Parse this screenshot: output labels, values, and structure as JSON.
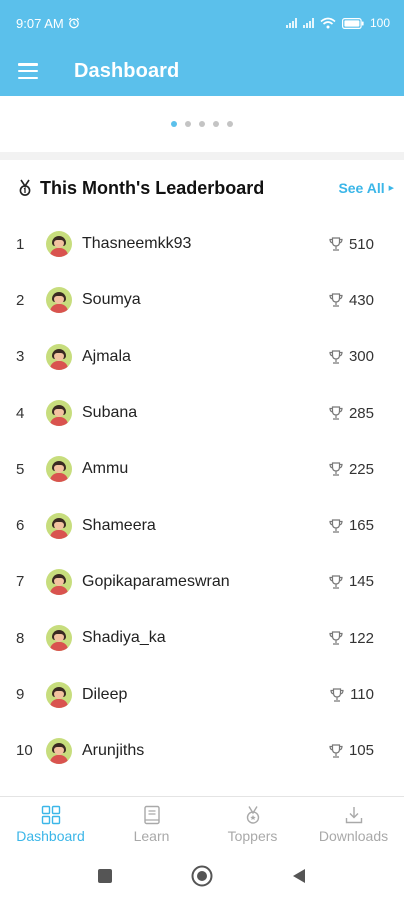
{
  "status_bar": {
    "time": "9:07 AM",
    "battery": "100"
  },
  "app_bar": {
    "title": "Dashboard",
    "menu_icon": "hamburger-menu-icon"
  },
  "carousel": {
    "dot_count": 5,
    "active_index": 0
  },
  "leaderboard": {
    "title": "This Month's Leaderboard",
    "see_all_label": "See All",
    "entries": [
      {
        "rank": "1",
        "name": "Thasneemkk93",
        "score": "510"
      },
      {
        "rank": "2",
        "name": "Soumya",
        "score": "430"
      },
      {
        "rank": "3",
        "name": "Ajmala",
        "score": "300"
      },
      {
        "rank": "4",
        "name": "Subana",
        "score": "285"
      },
      {
        "rank": "5",
        "name": "Ammu",
        "score": "225"
      },
      {
        "rank": "6",
        "name": "Shameera",
        "score": "165"
      },
      {
        "rank": "7",
        "name": "Gopikaparameswran",
        "score": "145"
      },
      {
        "rank": "8",
        "name": "Shadiya_ka",
        "score": "122"
      },
      {
        "rank": "9",
        "name": "Dileep",
        "score": "110"
      },
      {
        "rank": "10",
        "name": "Arunjiths",
        "score": "105"
      }
    ]
  },
  "bottom_nav": [
    {
      "label": "Dashboard",
      "icon": "dashboard-grid-icon",
      "active": true
    },
    {
      "label": "Learn",
      "icon": "book-icon",
      "active": false
    },
    {
      "label": "Toppers",
      "icon": "medal-icon",
      "active": false
    },
    {
      "label": "Downloads",
      "icon": "download-icon",
      "active": false
    }
  ],
  "colors": {
    "accent": "#5bc0eb",
    "link": "#3bb6e8",
    "inactive": "#a9a9a9"
  }
}
